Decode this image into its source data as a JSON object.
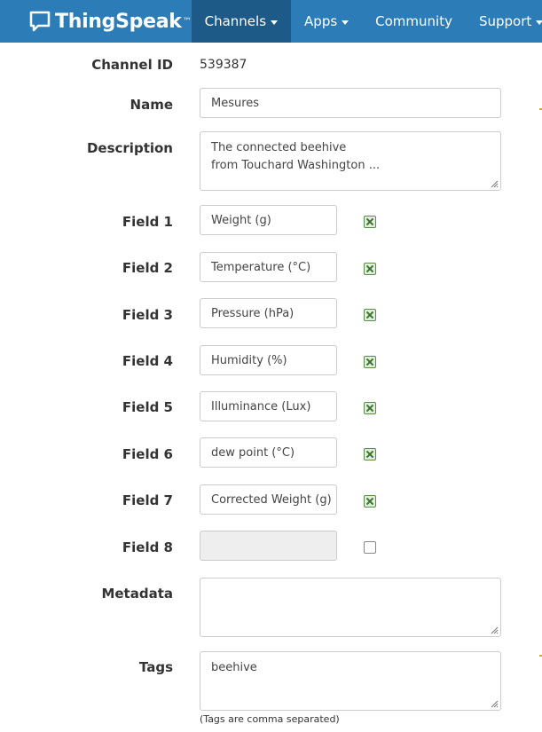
{
  "navbar": {
    "brand": "ThingSpeak",
    "brand_tm": "™",
    "items": [
      {
        "label": "Channels",
        "active": true,
        "dropdown": true
      },
      {
        "label": "Apps",
        "active": false,
        "dropdown": true
      },
      {
        "label": "Community",
        "active": false,
        "dropdown": false
      },
      {
        "label": "Support",
        "active": false,
        "dropdown": true
      }
    ]
  },
  "form": {
    "channel_id_label": "Channel ID",
    "channel_id_value": "539387",
    "name_label": "Name",
    "name_value": "Mesures",
    "description_label": "Description",
    "description_line1": "The connected beehive",
    "description_line2": "from Touchard Washington ...",
    "fields": [
      {
        "label": "Field 1",
        "value": "Weight (g)",
        "checked": true
      },
      {
        "label": "Field 2",
        "value": "Temperature (°C)",
        "checked": true
      },
      {
        "label": "Field 3",
        "value": "Pressure (hPa)",
        "checked": true
      },
      {
        "label": "Field 4",
        "value": "Humidity (%)",
        "checked": true
      },
      {
        "label": "Field 5",
        "value": "Illuminance (Lux)",
        "checked": true
      },
      {
        "label": "Field 6",
        "value": "dew point (°C)",
        "checked": true
      },
      {
        "label": "Field 7",
        "value": "Corrected Weight (g)",
        "checked": true
      },
      {
        "label": "Field 8",
        "value": "",
        "checked": false
      }
    ],
    "metadata_label": "Metadata",
    "metadata_value": "",
    "tags_label": "Tags",
    "tags_value": "beehive",
    "tags_hint": "(Tags are comma separated)"
  },
  "colors": {
    "navbar": "#2c7cb7",
    "navbar_active": "#1e5a87",
    "checkbox_checked": "#dff0d8"
  }
}
